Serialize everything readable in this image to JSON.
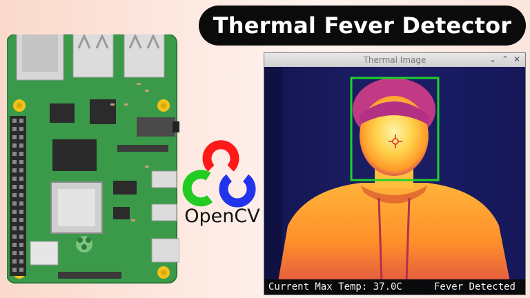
{
  "banner": {
    "title": "Thermal Fever Detector"
  },
  "logo": {
    "name": "OpenCV",
    "colors": {
      "red": "#ff1a1a",
      "green": "#22cc22",
      "blue": "#2233ee"
    }
  },
  "board": {
    "name": "raspberry-pi"
  },
  "window": {
    "title": "Thermal Image",
    "controls": {
      "menu": "⌄",
      "minimize": "⌃",
      "close": "✕"
    }
  },
  "status": {
    "temperature": "Current Max Temp: 37.0C",
    "result": "Fever Detected"
  },
  "colors": {
    "detection_box": "#1fd12a",
    "crosshair": "#d12525",
    "title_pill": "#0b0b0b"
  }
}
